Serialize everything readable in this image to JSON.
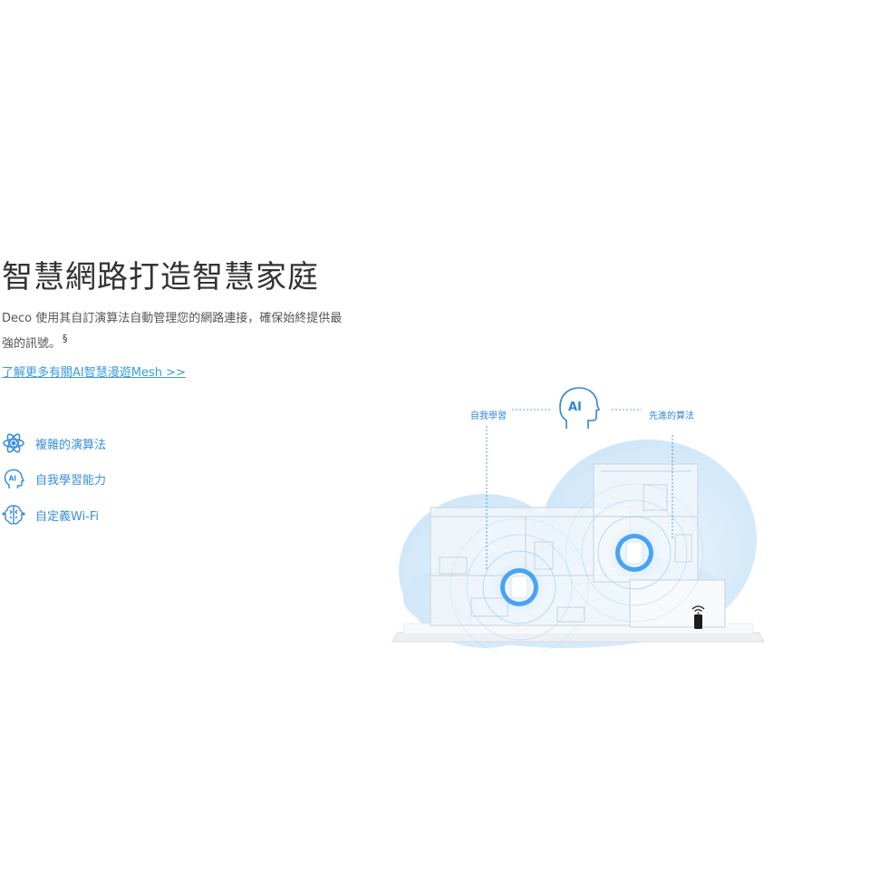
{
  "section": {
    "title": "智慧網路打造智慧家庭",
    "description": "Deco 使用其自訂演算法自動管理您的網路連接，確保始終提供最強的訊號。",
    "footnote_mark": "§",
    "learn_more_link": "了解更多有關AI智慧漫遊Mesh >>"
  },
  "features": [
    {
      "icon": "atom-icon",
      "label": "複雜的演算法"
    },
    {
      "icon": "ai-head-icon",
      "label": "自我學習能力"
    },
    {
      "icon": "brain-icon",
      "label": "自定義Wi-Fi"
    }
  ],
  "illustration": {
    "left_label": "自我學習",
    "right_label": "先進的算法",
    "badge_text": "AI"
  },
  "colors": {
    "accent": "#3a8fd8",
    "link": "#3a9ae0",
    "heading": "#333333"
  }
}
